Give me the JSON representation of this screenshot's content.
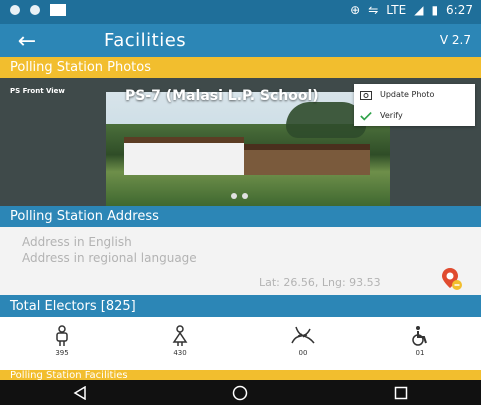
{
  "status_bar": {
    "lte": "LTE",
    "time": "6:27"
  },
  "app_bar": {
    "title": "Facilities",
    "version": "V 2.7"
  },
  "sections": {
    "photos_header": "Polling Station Photos",
    "address_header": "Polling Station Address",
    "electors_header": "Total Electors [825]",
    "facilities_header": "Polling Station Facilities"
  },
  "photo": {
    "view_label": "PS Front View",
    "station_name": "PS-7 (Malasi L.P. School)"
  },
  "photo_menu": {
    "update_photo": "Update Photo",
    "verify": "Verify"
  },
  "address": {
    "english_placeholder": "Address in English",
    "regional_placeholder": "Address in regional language",
    "lat_lng": "Lat: 26.56, Lng: 93.53"
  },
  "electors": {
    "male": "395",
    "female": "430",
    "third_gender": "00",
    "pwd": "01"
  },
  "icons": {
    "back": "arrow-left-icon",
    "map_pin": "map-pin-icon",
    "male": "male-icon",
    "female": "female-icon",
    "third_gender": "dna-icon",
    "pwd": "wheelchair-icon"
  },
  "colors": {
    "primary": "#2c86b6",
    "accent": "#f2be2e",
    "dark": "#1f6f9a"
  }
}
